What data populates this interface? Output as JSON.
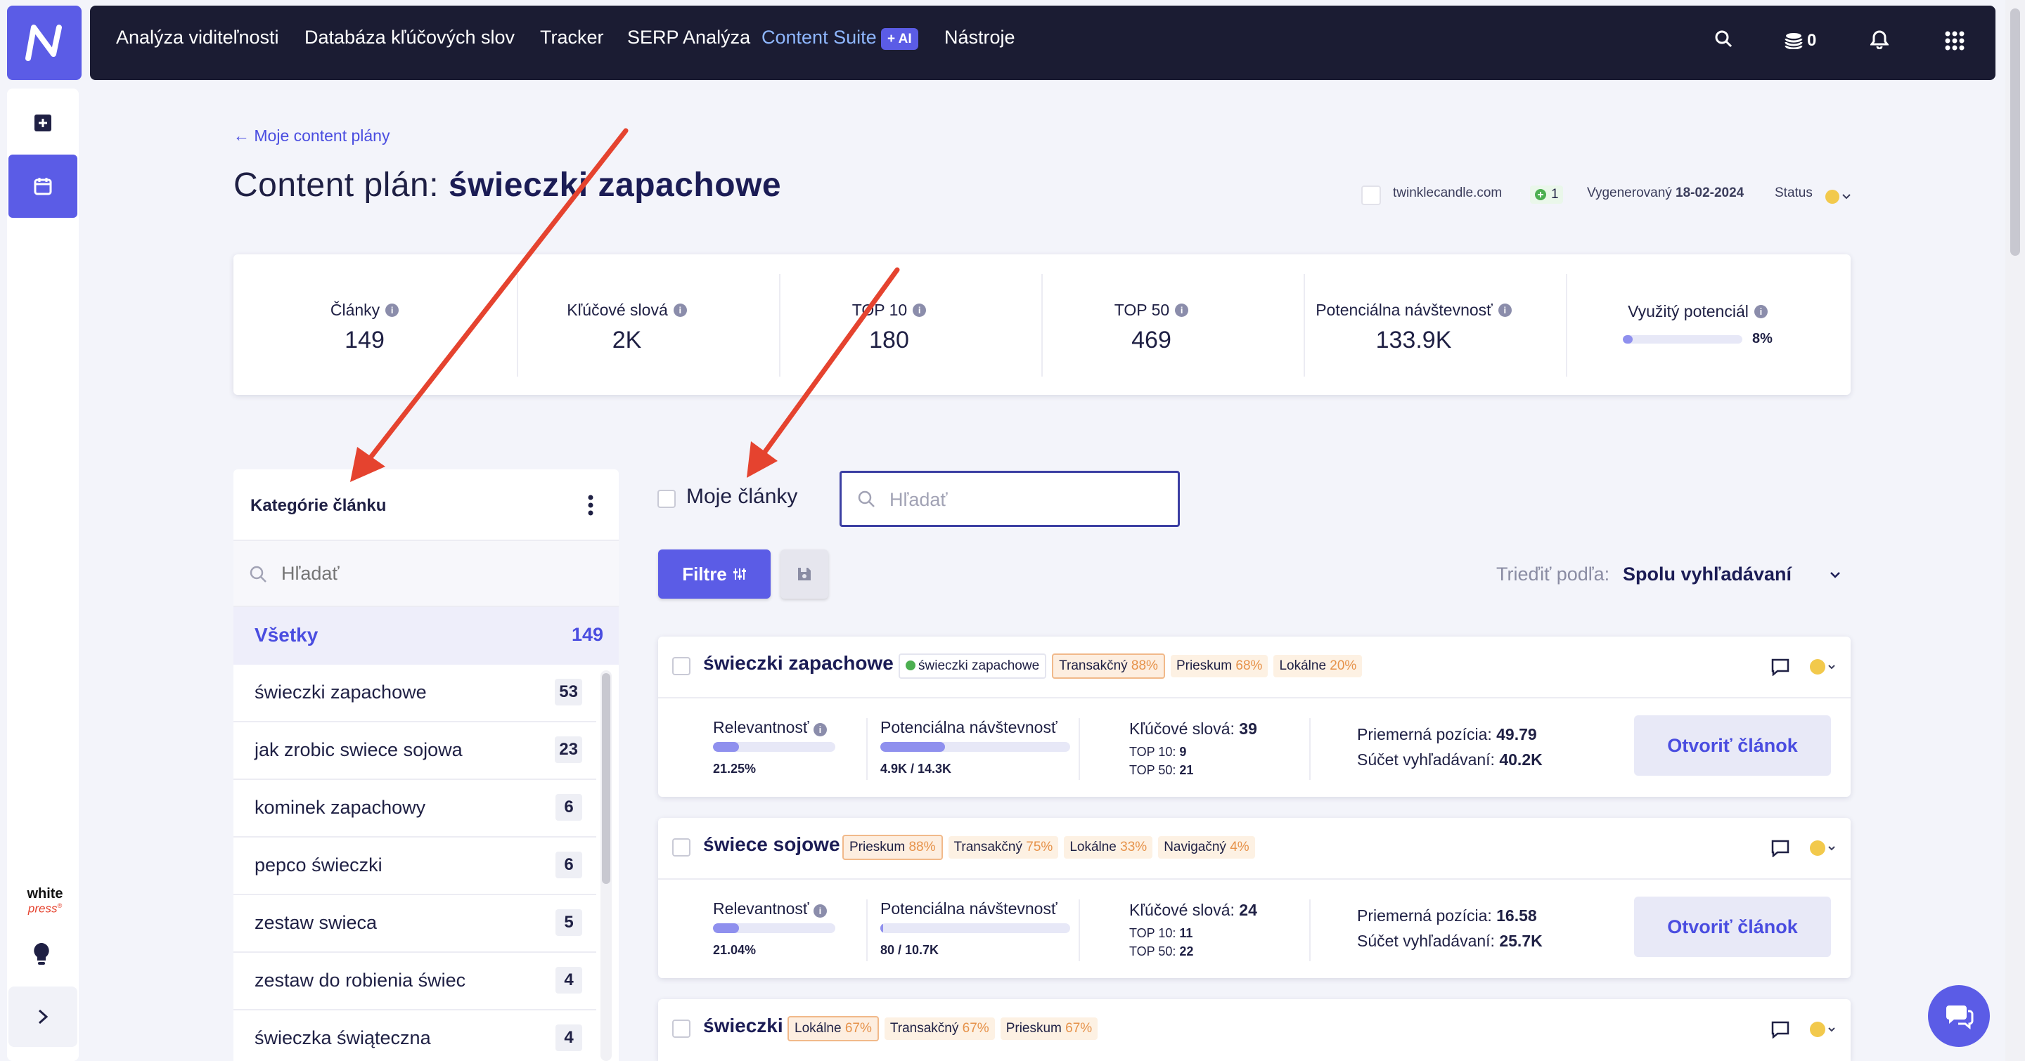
{
  "topnav": {
    "items": [
      "Analýza viditeľnosti",
      "Databáza kľúčových slov",
      "Tracker",
      "SERP Analýza",
      "Content Suite",
      "Nástroje"
    ],
    "ai_badge": "+ AI",
    "credits": "0"
  },
  "rail": {
    "brand": "whitepress"
  },
  "header": {
    "back_link": "← Moje content plány",
    "title_prefix": "Content plán:",
    "title_keyword": "świeczki zapachowe",
    "domain": "twinklecandle.com",
    "count": "1",
    "generated_label": "Vygenerovaný",
    "generated_date": "18-02-2024",
    "status_label": "Status"
  },
  "stats": [
    {
      "label": "Články",
      "value": "149"
    },
    {
      "label": "Kľúčové slová",
      "value": "2K"
    },
    {
      "label": "TOP 10",
      "value": "180"
    },
    {
      "label": "TOP 50",
      "value": "469"
    },
    {
      "label": "Potenciálna návštevnosť",
      "value": "133.9K"
    },
    {
      "label": "Využitý potenciál",
      "value": "8%",
      "progress": 0.08
    }
  ],
  "categories": {
    "title": "Kategórie článku",
    "search_placeholder": "Hľadať",
    "all_label": "Všetky",
    "all_count": "149",
    "items": [
      {
        "name": "świeczki zapachowe",
        "count": "53"
      },
      {
        "name": "jak zrobic swiece sojowa",
        "count": "23"
      },
      {
        "name": "kominek zapachowy",
        "count": "6"
      },
      {
        "name": "pepco świeczki",
        "count": "6"
      },
      {
        "name": "zestaw swieca",
        "count": "5"
      },
      {
        "name": "zestaw do robienia świec",
        "count": "4"
      },
      {
        "name": "świeczka świąteczna",
        "count": "4"
      }
    ]
  },
  "filters": {
    "my_articles": "Moje články",
    "search_placeholder": "Hľadať",
    "filter_button": "Filtre",
    "sort_label": "Trieďiť podľa:",
    "sort_value": "Spolu vyhľadávaní"
  },
  "articles": [
    {
      "title": "świeczki zapachowe",
      "keyword_tag": "świeczki zapachowe",
      "tags": [
        {
          "name": "Transakčný",
          "pct": "88%"
        },
        {
          "name": "Prieskum",
          "pct": "68%"
        },
        {
          "name": "Lokálne",
          "pct": "20%"
        }
      ],
      "relevance_label": "Relevantnosť",
      "relevance": "21.25%",
      "relevance_fill": 0.2125,
      "traffic_label": "Potenciálna návštevnosť",
      "traffic": "4.9K / 14.3K",
      "traffic_fill": 0.34,
      "keywords_label": "Kľúčové slová:",
      "keywords": "39",
      "top10_label": "TOP 10:",
      "top10": "9",
      "top50_label": "TOP 50:",
      "top50": "21",
      "avg_pos_label": "Priemerná pozícia:",
      "avg_pos": "49.79",
      "searches_label": "Súčet vyhľadávaní:",
      "searches": "40.2K",
      "open_button": "Otvoriť článok"
    },
    {
      "title": "świece sojowe",
      "tags": [
        {
          "name": "Prieskum",
          "pct": "88%"
        },
        {
          "name": "Transakčný",
          "pct": "75%"
        },
        {
          "name": "Lokálne",
          "pct": "33%"
        },
        {
          "name": "Navigačný",
          "pct": "4%"
        }
      ],
      "relevance_label": "Relevantnosť",
      "relevance": "21.04%",
      "relevance_fill": 0.2104,
      "traffic_label": "Potenciálna návštevnosť",
      "traffic": "80 / 10.7K",
      "traffic_fill": 0.0075,
      "keywords_label": "Kľúčové slová:",
      "keywords": "24",
      "top10_label": "TOP 10:",
      "top10": "11",
      "top50_label": "TOP 50:",
      "top50": "22",
      "avg_pos_label": "Priemerná pozícia:",
      "avg_pos": "16.58",
      "searches_label": "Súčet vyhľadávaní:",
      "searches": "25.7K",
      "open_button": "Otvoriť článok"
    },
    {
      "title": "świeczki",
      "tags": [
        {
          "name": "Lokálne",
          "pct": "67%"
        },
        {
          "name": "Transakčný",
          "pct": "67%"
        },
        {
          "name": "Prieskum",
          "pct": "67%"
        }
      ]
    }
  ],
  "colors": {
    "accent": "#5b5ce6",
    "nav_bg": "#1b1c33",
    "annotation_arrow": "#e5432f",
    "status": "#f2c94c"
  }
}
